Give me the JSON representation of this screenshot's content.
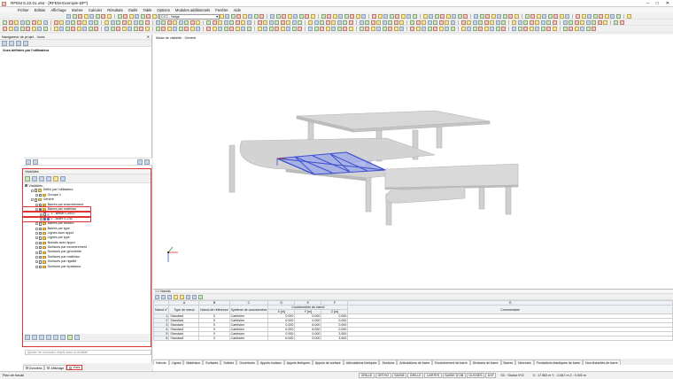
{
  "title": "RFEM 5.22.01.x64 - [RFEM-Exemple-DP*]",
  "menu": [
    "Fichier",
    "Edition",
    "Affichage",
    "Insérer",
    "Calculer",
    "Résultats",
    "Outils",
    "Table",
    "Options",
    "Modules additionnels",
    "Fenêtre",
    "Aide"
  ],
  "load_combo": "CC2 - Neige",
  "navigator": {
    "title": "Navigateur de projet - Vues",
    "user_views_label": "Vues définies par l'utilisateur",
    "visibility_title": "Visibilités",
    "visibility_check": "Visibilités :",
    "tree": [
      {
        "level": 1,
        "label": "Défini par l'utilisateur",
        "checked": false,
        "folder": true
      },
      {
        "level": 2,
        "label": "Groupe 1",
        "checked": false,
        "folder": true
      },
      {
        "level": 1,
        "label": "Généré",
        "checked": false,
        "folder": true
      },
      {
        "level": 2,
        "label": "Barres par excentrement",
        "checked": false,
        "folder": true
      },
      {
        "level": 2,
        "label": "Barres par matériau",
        "checked": true,
        "folder": true
      },
      {
        "level": 3,
        "label": "1 - Béton C30/37",
        "checked": false,
        "folder": false,
        "color": "#c8c8c8"
      },
      {
        "level": 3,
        "label": "2 - Acier S 235",
        "checked": true,
        "folder": false,
        "color": "#3a62d6"
      },
      {
        "level": 2,
        "label": "Barres par section",
        "checked": false,
        "folder": true
      },
      {
        "level": 2,
        "label": "Barres par type",
        "checked": false,
        "folder": true
      },
      {
        "level": 2,
        "label": "Lignes avec appui",
        "checked": false,
        "folder": true
      },
      {
        "level": 2,
        "label": "Lignes par type",
        "checked": false,
        "folder": true
      },
      {
        "level": 2,
        "label": "Nœuds avec appui",
        "checked": false,
        "folder": true
      },
      {
        "level": 2,
        "label": "Surfaces par excentrement",
        "checked": false,
        "folder": true
      },
      {
        "level": 2,
        "label": "Surfaces par géométrie",
        "checked": false,
        "folder": true
      },
      {
        "level": 2,
        "label": "Surfaces par matériau",
        "checked": false,
        "folder": true
      },
      {
        "level": 2,
        "label": "Surfaces par rigidité",
        "checked": false,
        "folder": true
      },
      {
        "level": 2,
        "label": "Surfaces par épaisseur",
        "checked": false,
        "folder": true
      }
    ],
    "add_objects_placeholder": "Ajouter de nouveaux objets dans la visibilité",
    "bottom_tabs": [
      "Données",
      "Affichage",
      "Vues"
    ]
  },
  "viewport": {
    "label": "Mode de visibilité - Généré"
  },
  "table": {
    "title": "1.1 Nœuds",
    "col_letters": [
      "A",
      "B",
      "C",
      "D",
      "E",
      "F",
      "G"
    ],
    "group_header": "Coordonnées du nœud",
    "headers": [
      "Nœud n°",
      "Type de nœud",
      "Nœud de référence",
      "Système de coordonnées",
      "X [m]",
      "Y [m]",
      "Z [m]",
      "Commentaire"
    ],
    "rows": [
      [
        "1",
        "Standard",
        "0",
        "Cartésien",
        "0.000",
        "0.000",
        "0.000",
        ""
      ],
      [
        "2",
        "Standard",
        "0",
        "Cartésien",
        "6.000",
        "0.000",
        "0.000",
        ""
      ],
      [
        "3",
        "Standard",
        "0",
        "Cartésien",
        "0.000",
        "6.000",
        "0.000",
        ""
      ],
      [
        "4",
        "Standard",
        "0",
        "Cartésien",
        "6.000",
        "6.000",
        "0.000",
        ""
      ],
      [
        "5",
        "Standard",
        "0",
        "Cartésien",
        "0.000",
        "0.000",
        "3.500",
        ""
      ],
      [
        "6",
        "Standard",
        "0",
        "Cartésien",
        "6.000",
        "0.000",
        "3.500",
        ""
      ]
    ],
    "tabs": [
      "Nœuds",
      "Lignes",
      "Matériaux",
      "Surfaces",
      "Solides",
      "Ouvertures",
      "Appuis nodaux",
      "Appuis linéiques",
      "Appuis de surface",
      "Articulations linéiques",
      "Sections",
      "Articulations de barre",
      "Excentrement de barre",
      "Divisions de barre",
      "Barres",
      "Nervures",
      "Fondations élastiques de barre",
      "Non-linéarités de barre"
    ]
  },
  "status": {
    "left": "Plan de travail",
    "buttons": [
      "GRILLE",
      "ORTHO",
      "SAISIE",
      "GRILLE",
      "CARTES",
      "SAISIE D'OB",
      "GLISSES",
      "DXF"
    ],
    "system": "SC : Global XYZ",
    "plan": "Plan : XY",
    "coords": "X : 17.563 m   Y : -0.847 m   Z : 0.000 m"
  }
}
